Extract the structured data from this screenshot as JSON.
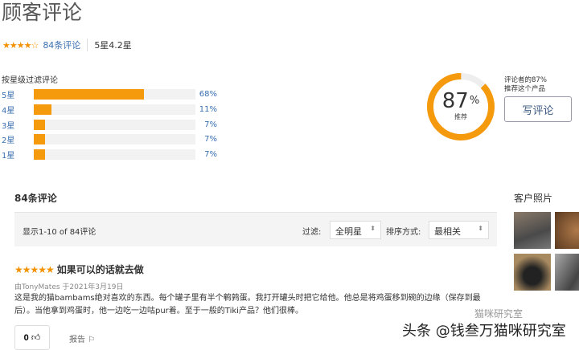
{
  "title": "顾客评论",
  "summary": {
    "stars": "★★★★☆",
    "count_link": "84条评论",
    "rating": "5星4.2星"
  },
  "filter_label": "按星级过滤评论",
  "breakdown": [
    {
      "label": "5星",
      "percent": 68,
      "text": "68%"
    },
    {
      "label": "4星",
      "percent": 11,
      "text": "11%"
    },
    {
      "label": "3星",
      "percent": 7,
      "text": "7%"
    },
    {
      "label": "2星",
      "percent": 7,
      "text": "7%"
    },
    {
      "label": "1星",
      "percent": 7,
      "text": "7%"
    }
  ],
  "recommend": {
    "percent": 87,
    "number": "87",
    "unit": "%",
    "sub": "推荐",
    "line1": "评论者的87%",
    "line2": "推荐这个产品"
  },
  "write_button": "写评论",
  "reviews_heading": "84条评论",
  "toolbar": {
    "showing": "显示1-10 of 84评论",
    "filter_label": "过滤:",
    "filter_value": "全明星",
    "sort_label": "排序方式:",
    "sort_value": "最相关"
  },
  "review": {
    "stars": "★★★★★",
    "title": "如果可以的话就去做",
    "byline": "由TonyMates 于2021年3月19日",
    "body": "这是我的猫bambams绝对喜欢的东西。每个罐子里有半个鹌鹑蛋。我打开罐头时把它给他。他总是将鸡蛋移到碗的边缘（保存到最后）。当他拿到鸡蛋时，他一边吃一边咕pur着。至于一般的Tiki产品？他们很棒。",
    "likes": "0",
    "report": "报告"
  },
  "photos_heading": "客户照片",
  "watermark": "头条 @钱叁万猫咪研究室",
  "watermark2": "猫咪研究室",
  "colors": {
    "accent": "#f59a0c",
    "link": "#3a6fb0"
  }
}
